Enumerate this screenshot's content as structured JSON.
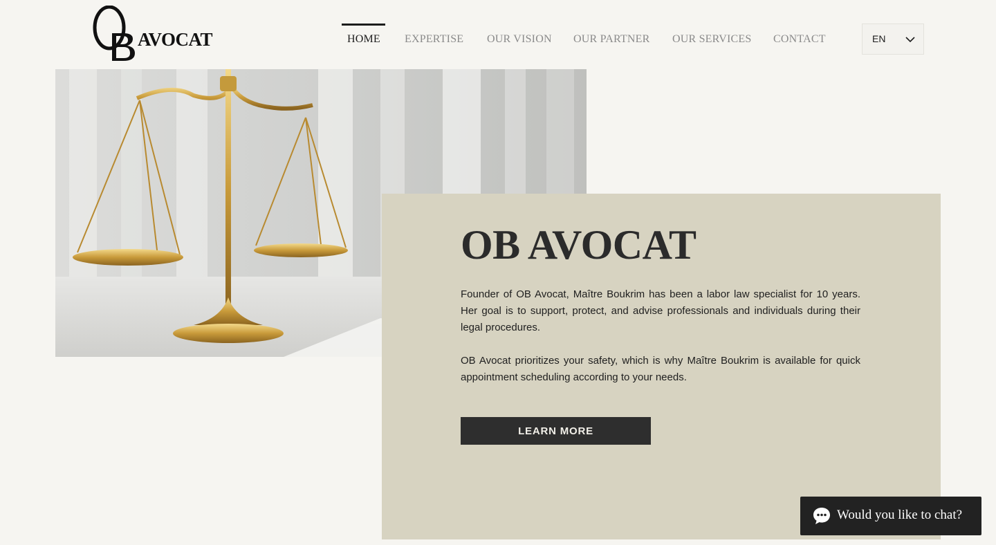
{
  "brand": {
    "logo_word": "AVOCAT",
    "logo_monogram": "OB"
  },
  "nav": {
    "items": [
      {
        "label": "HOME",
        "active": true
      },
      {
        "label": "EXPERTISE",
        "active": false
      },
      {
        "label": "OUR VISION",
        "active": false
      },
      {
        "label": "OUR PARTNER",
        "active": false
      },
      {
        "label": "OUR SERVICES",
        "active": false
      },
      {
        "label": "CONTACT",
        "active": false
      }
    ]
  },
  "language": {
    "selected": "EN",
    "icon": "chevron-down-icon"
  },
  "hero": {
    "image_icon": "scales-of-justice-image"
  },
  "about": {
    "title": "OB AVOCAT",
    "paragraph_1": "Founder of OB Avocat, Maître Boukrim has been a labor law specialist for 10 years. Her goal is to support, protect, and advise professionals and individuals during their legal procedures.",
    "paragraph_2": "OB Avocat prioritizes your safety, which is why Maître Boukrim is available for quick appointment scheduling according to your needs.",
    "button_label": "LEARN MORE"
  },
  "chat": {
    "label": "Would you like to chat?",
    "icon": "chat-bubble-icon"
  },
  "colors": {
    "background": "#f6f5f1",
    "card": "#d7d3c1",
    "button": "#2e2e2e",
    "chat": "#222222",
    "nav_active": "#1c1c1c",
    "nav_inactive": "#8a8a8a"
  }
}
